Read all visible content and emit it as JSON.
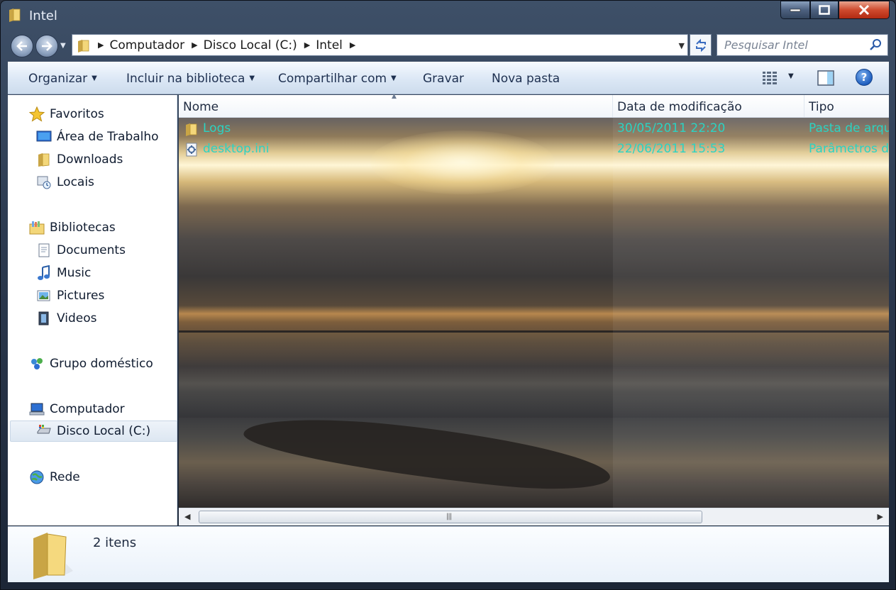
{
  "window": {
    "title": "Intel"
  },
  "address": {
    "crumbs": [
      "Computador",
      "Disco Local (C:)",
      "Intel"
    ]
  },
  "search": {
    "placeholder": "Pesquisar Intel"
  },
  "toolbar": {
    "organize": "Organizar",
    "include_library": "Incluir na biblioteca",
    "share_with": "Compartilhar com",
    "burn": "Gravar",
    "new_folder": "Nova pasta",
    "help": "?"
  },
  "sidebar": {
    "favorites": {
      "label": "Favoritos",
      "items": [
        "Área de Trabalho",
        "Downloads",
        "Locais"
      ]
    },
    "libraries": {
      "label": "Bibliotecas",
      "items": [
        "Documents",
        "Music",
        "Pictures",
        "Videos"
      ]
    },
    "homegroup": {
      "label": "Grupo doméstico"
    },
    "computer": {
      "label": "Computador",
      "items": [
        "Disco Local (C:)"
      ]
    },
    "network": {
      "label": "Rede"
    }
  },
  "filelist": {
    "columns": [
      "Nome",
      "Data de modificação",
      "Tipo"
    ],
    "rows": [
      {
        "name": "Logs",
        "modified": "30/05/2011 22:20",
        "type": "Pasta de arqui",
        "icon": "folder-icon"
      },
      {
        "name": "desktop.ini",
        "modified": "22/06/2011 15:53",
        "type": "Parâmetros de",
        "icon": "settings-file-icon"
      }
    ],
    "text_color": "#2bd3c3"
  },
  "details": {
    "count": "2 itens"
  }
}
